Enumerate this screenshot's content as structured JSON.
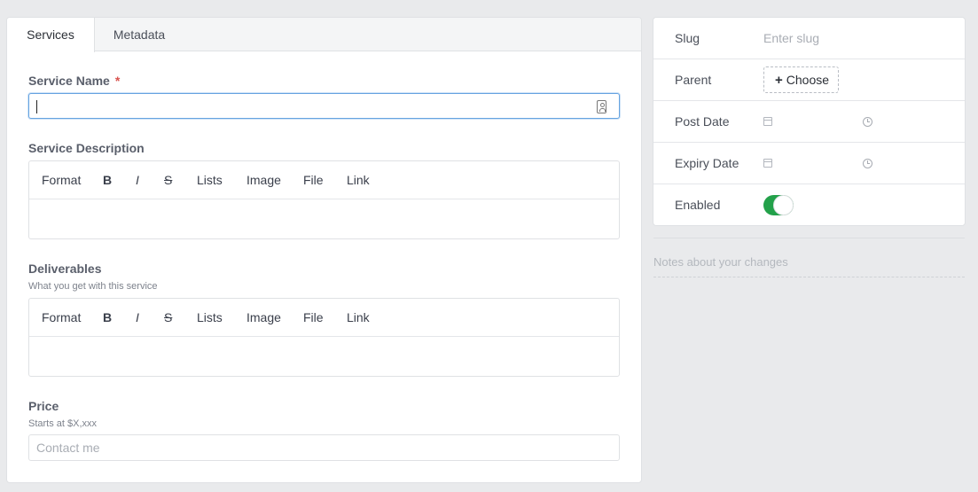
{
  "tabs": [
    {
      "label": "Services",
      "active": true
    },
    {
      "label": "Metadata",
      "active": false
    }
  ],
  "service_name": {
    "label": "Service Name",
    "required_mark": "*",
    "value": ""
  },
  "service_description": {
    "label": "Service Description"
  },
  "deliverables": {
    "label": "Deliverables",
    "hint": "What you get with this service"
  },
  "editor_toolbar": {
    "format": "Format",
    "bold": "B",
    "italic": "I",
    "strike": "S",
    "lists": "Lists",
    "image": "Image",
    "file": "File",
    "link": "Link"
  },
  "price": {
    "label": "Price",
    "hint": "Starts at $X,xxx",
    "placeholder": "Contact me"
  },
  "sidebar": {
    "slug": {
      "label": "Slug",
      "placeholder": "Enter slug"
    },
    "parent": {
      "label": "Parent",
      "button": "Choose",
      "button_icon": "plus-icon"
    },
    "post_date": {
      "label": "Post Date",
      "icons": [
        "calendar-icon",
        "clock-icon"
      ]
    },
    "expiry_date": {
      "label": "Expiry Date",
      "icons": [
        "calendar-icon",
        "clock-icon"
      ]
    },
    "enabled": {
      "label": "Enabled",
      "on": true,
      "color": "#23a14a"
    }
  },
  "notes": {
    "placeholder": "Notes about your changes"
  }
}
